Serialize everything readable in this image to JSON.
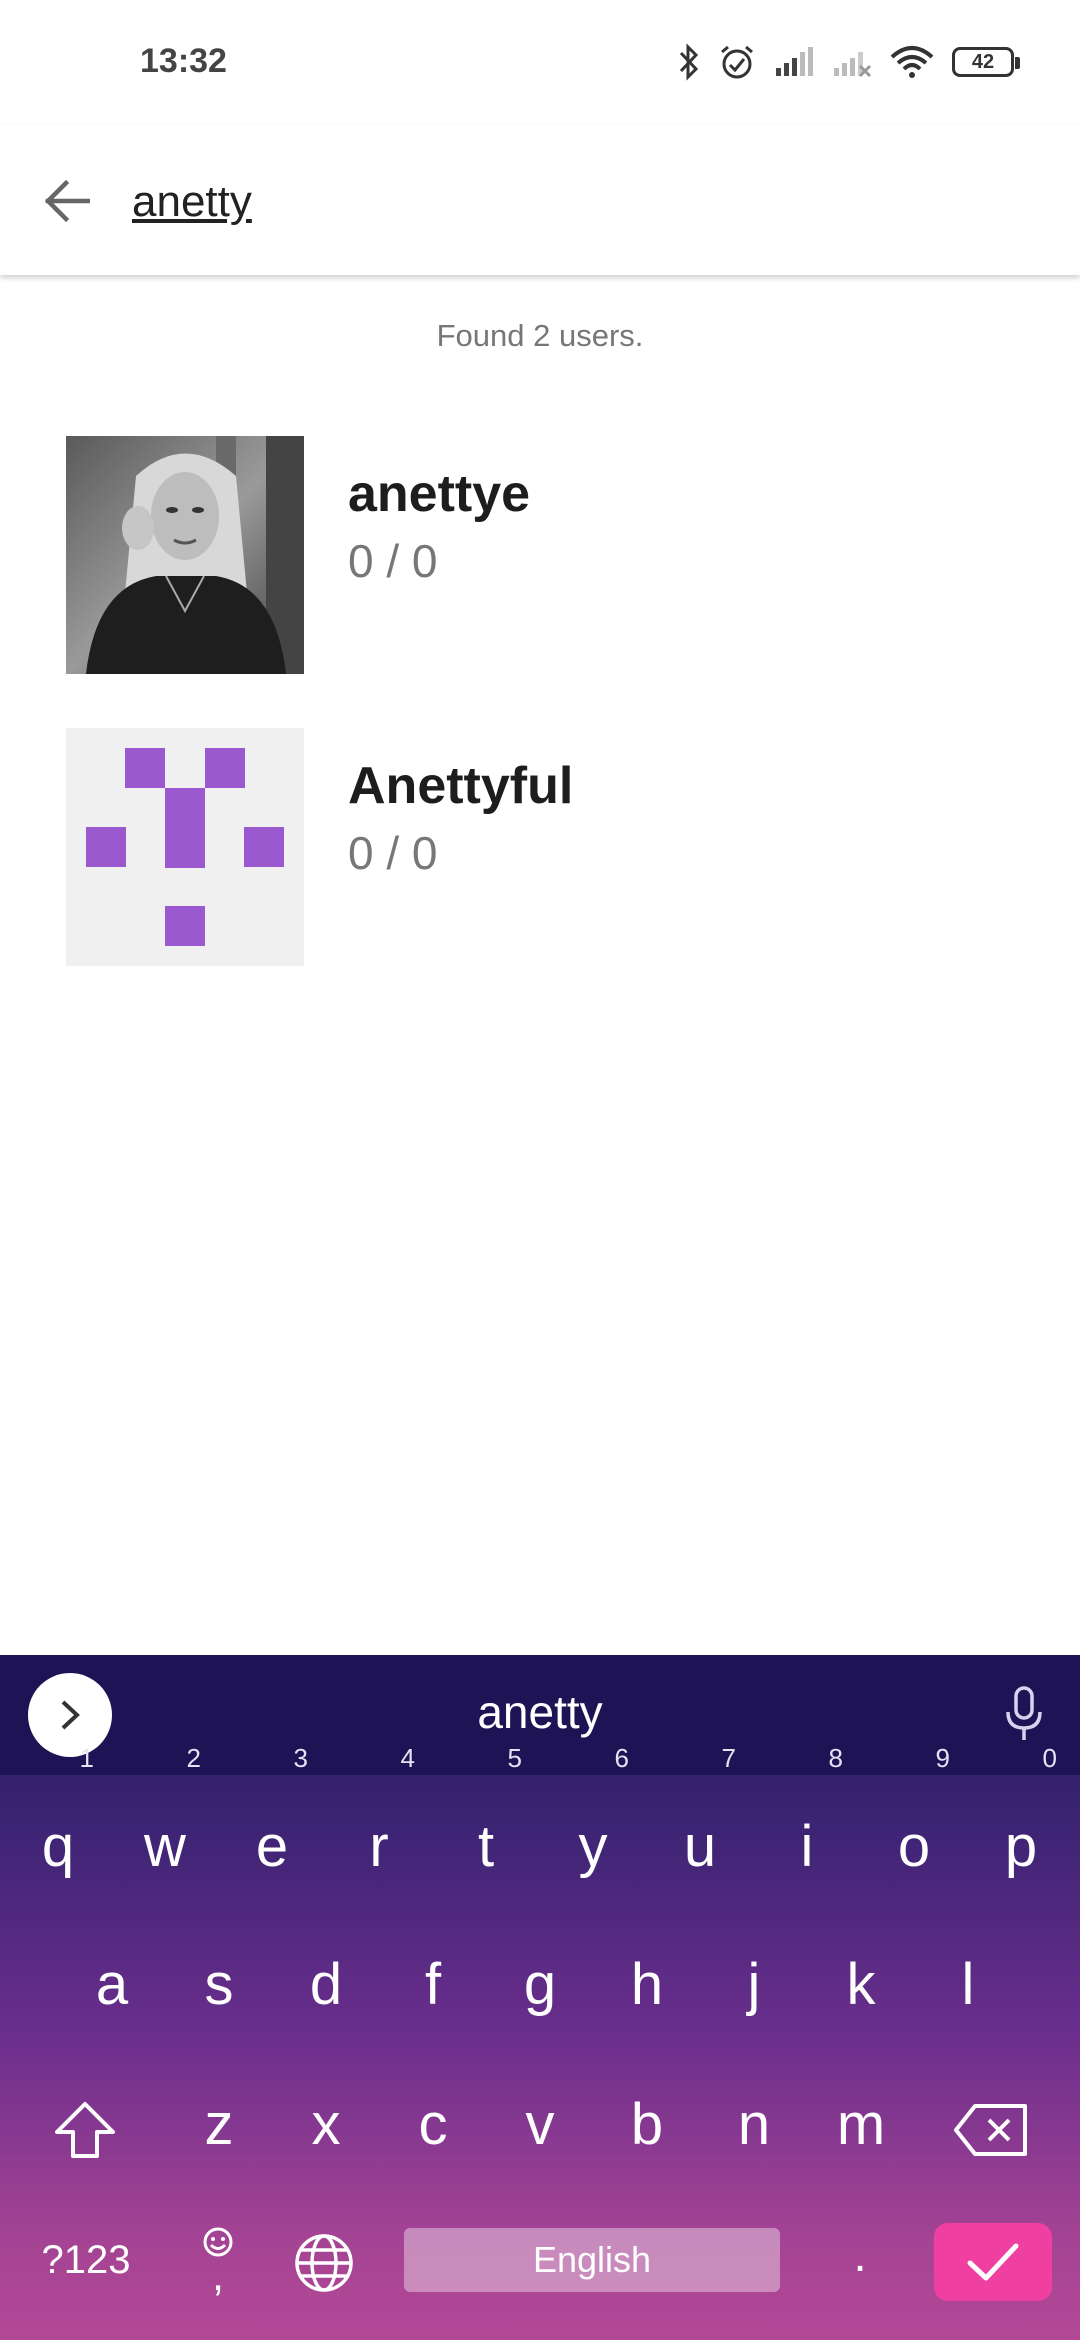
{
  "status_bar": {
    "time": "13:32",
    "battery": "42",
    "icons": [
      "bluetooth-icon",
      "alarm-icon",
      "signal-icon",
      "signal-off-icon",
      "wifi-icon",
      "battery-icon"
    ]
  },
  "toolbar": {
    "back_icon": "arrow-left-icon",
    "search_value": "anetty"
  },
  "results": {
    "summary": "Found 2 users.",
    "items": [
      {
        "name": "anettye",
        "stats": "0 / 0"
      },
      {
        "name": "Anettyful",
        "stats": "0 / 0"
      }
    ]
  },
  "keyboard": {
    "suggestion": "anetty",
    "row1": [
      {
        "key": "q",
        "hint": "1"
      },
      {
        "key": "w",
        "hint": "2"
      },
      {
        "key": "e",
        "hint": "3"
      },
      {
        "key": "r",
        "hint": "4"
      },
      {
        "key": "t",
        "hint": "5"
      },
      {
        "key": "y",
        "hint": "6"
      },
      {
        "key": "u",
        "hint": "7"
      },
      {
        "key": "i",
        "hint": "8"
      },
      {
        "key": "o",
        "hint": "9"
      },
      {
        "key": "p",
        "hint": "0"
      }
    ],
    "row2": [
      "a",
      "s",
      "d",
      "f",
      "g",
      "h",
      "j",
      "k",
      "l"
    ],
    "row3": [
      "z",
      "x",
      "c",
      "v",
      "b",
      "n",
      "m"
    ],
    "symbols_label": "?123",
    "comma_label": ",",
    "space_label": "English",
    "period_label": ".",
    "colors": {
      "enter": "#ef3fa0",
      "identicon": "#9b59d0",
      "identicon_bg": "#f0f0f0"
    }
  }
}
